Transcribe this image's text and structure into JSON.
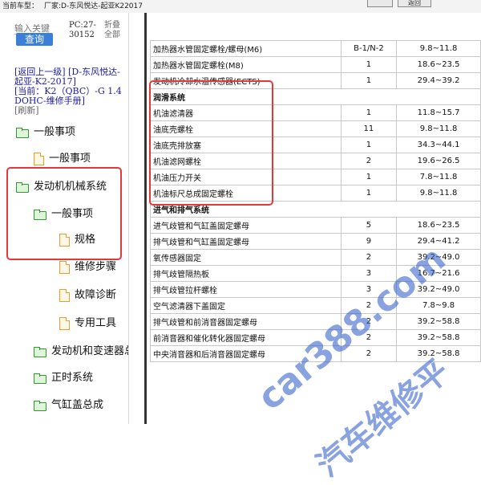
{
  "topbar": {
    "label": "当前车型：",
    "model": "厂家:D-东风悦达-起亚K22017",
    "buttons": [
      "",
      "返回"
    ]
  },
  "sidebar": {
    "search_placeholder": "输入关键",
    "search_button": "查询",
    "pc_code": "PC:27-30152",
    "fold_label": "折叠全部",
    "nav": {
      "back_link": "[返回上一级]",
      "back_target": "[D-东风悦达-起亚-K2-2017]",
      "current_link": "[当前：K2（QBC）-G 1.4 DOHC-维修手册]",
      "refresh": "[刷新]"
    },
    "tree": [
      {
        "label": "一般事项",
        "type": "folder"
      },
      {
        "label": "一般事项",
        "type": "doc"
      },
      {
        "label": "发动机机械系统",
        "type": "folder"
      },
      {
        "label": "一般事项",
        "type": "folder"
      },
      {
        "label": "规格",
        "type": "doc"
      },
      {
        "label": "维修步骤",
        "type": "doc"
      },
      {
        "label": "故障诊断",
        "type": "doc"
      },
      {
        "label": "专用工具",
        "type": "doc"
      },
      {
        "label": "发动机和变速器总成",
        "type": "folder"
      },
      {
        "label": "正时系统",
        "type": "folder"
      },
      {
        "label": "气缸盖总成",
        "type": "folder"
      }
    ]
  },
  "table": {
    "rows": [
      {
        "name": "加热器水管固定螺栓/螺母(M6)",
        "qty": "B-1/N-2",
        "torque": "9.8~11.8"
      },
      {
        "name": "加热器水管固定螺栓(M8)",
        "qty": "1",
        "torque": "18.6~23.5"
      },
      {
        "name": "发动机冷却水温传感器(ECTS)",
        "qty": "1",
        "torque": "29.4~39.2"
      },
      {
        "section": "润滑系统"
      },
      {
        "name": "机油滤清器",
        "qty": "1",
        "torque": "11.8~15.7"
      },
      {
        "name": "油底壳螺栓",
        "qty": "11",
        "torque": "9.8~11.8"
      },
      {
        "name": "油底壳排放塞",
        "qty": "1",
        "torque": "34.3~44.1"
      },
      {
        "name": "机油滤网螺栓",
        "qty": "2",
        "torque": "19.6~26.5"
      },
      {
        "name": "机油压力开关",
        "qty": "1",
        "torque": "7.8~11.8"
      },
      {
        "name": "机油标尺总成固定螺栓",
        "qty": "1",
        "torque": "9.8~11.8"
      },
      {
        "section": "进气和排气系统"
      },
      {
        "name": "进气歧管和气缸盖固定螺母",
        "qty": "5",
        "torque": "18.6~23.5"
      },
      {
        "name": "排气歧管和气缸盖固定螺母",
        "qty": "9",
        "torque": "29.4~41.2"
      },
      {
        "name": "氧传感器固定",
        "qty": "2",
        "torque": "39.2~49.0"
      },
      {
        "name": "排气歧管隔热板",
        "qty": "3",
        "torque": "16.7~21.6"
      },
      {
        "name": "排气歧管拉杆螺栓",
        "qty": "3",
        "torque": "39.2~49.0"
      },
      {
        "name": "空气滤清器下盖固定",
        "qty": "2",
        "torque": "7.8~9.8"
      },
      {
        "name": "排气歧管和前消音器固定螺母",
        "qty": "2",
        "torque": "39.2~58.8"
      },
      {
        "name": "前消音器和催化转化器固定螺母",
        "qty": "2",
        "torque": "39.2~58.8"
      },
      {
        "name": "中央消音器和后消音器固定螺母",
        "qty": "2",
        "torque": "39.2~58.8"
      }
    ]
  },
  "watermark": {
    "text1": "car388.com",
    "text2": "汽车维修平"
  },
  "colors": {
    "highlight": "#e23a3a",
    "search_button": "#3b80d6",
    "watermark": "#2a59c8"
  }
}
